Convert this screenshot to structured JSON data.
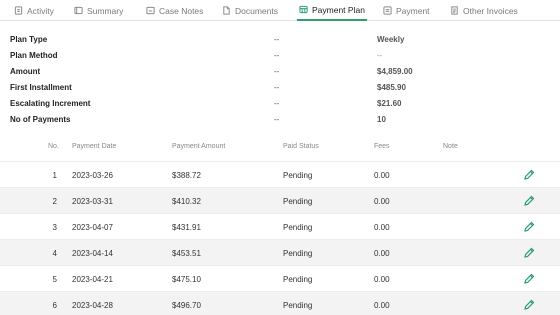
{
  "tabs": [
    {
      "label": "Activity",
      "icon": "activity-icon"
    },
    {
      "label": "Summary",
      "icon": "summary-icon"
    },
    {
      "label": "Case Notes",
      "icon": "case-notes-icon"
    },
    {
      "label": "Documents",
      "icon": "documents-icon"
    },
    {
      "label": "Payment Plan",
      "icon": "payment-plan-icon",
      "active": true
    },
    {
      "label": "Payment",
      "icon": "payment-icon"
    },
    {
      "label": "Other Invoices",
      "icon": "other-invoices-icon"
    }
  ],
  "summary": [
    {
      "label": "Plan Type",
      "dash": "--",
      "value": "Weekly"
    },
    {
      "label": "Plan Method",
      "dash": "--",
      "value": "--"
    },
    {
      "label": "Amount",
      "dash": "--",
      "value": "$4,859.00"
    },
    {
      "label": "First Installment",
      "dash": "--",
      "value": "$485.90"
    },
    {
      "label": "Escalating Increment",
      "dash": "--",
      "value": "$21.60"
    },
    {
      "label": "No of Payments",
      "dash": "--",
      "value": "10"
    }
  ],
  "table": {
    "headers": {
      "no": "No.",
      "payment_date": "Payment Date",
      "payment_amount": "Payment Amount",
      "paid_status": "Paid Status",
      "fees": "Fees",
      "note": "Note"
    },
    "rows": [
      {
        "no": "1",
        "date": "2023-03-26",
        "amount": "$388.72",
        "status": "Pending",
        "fees": "0.00",
        "note": ""
      },
      {
        "no": "2",
        "date": "2023-03-31",
        "amount": "$410.32",
        "status": "Pending",
        "fees": "0.00",
        "note": ""
      },
      {
        "no": "3",
        "date": "2023-04-07",
        "amount": "$431.91",
        "status": "Pending",
        "fees": "0.00",
        "note": ""
      },
      {
        "no": "4",
        "date": "2023-04-14",
        "amount": "$453.51",
        "status": "Pending",
        "fees": "0.00",
        "note": ""
      },
      {
        "no": "5",
        "date": "2023-04-21",
        "amount": "$475.10",
        "status": "Pending",
        "fees": "0.00",
        "note": ""
      },
      {
        "no": "6",
        "date": "2023-04-28",
        "amount": "$496.70",
        "status": "Pending",
        "fees": "0.00",
        "note": ""
      }
    ],
    "row_action_icon": "pencil-icon"
  },
  "colors": {
    "accent": "#2e9e6e",
    "alt_row": "#f3f3f3",
    "border": "#e3e3e3"
  }
}
